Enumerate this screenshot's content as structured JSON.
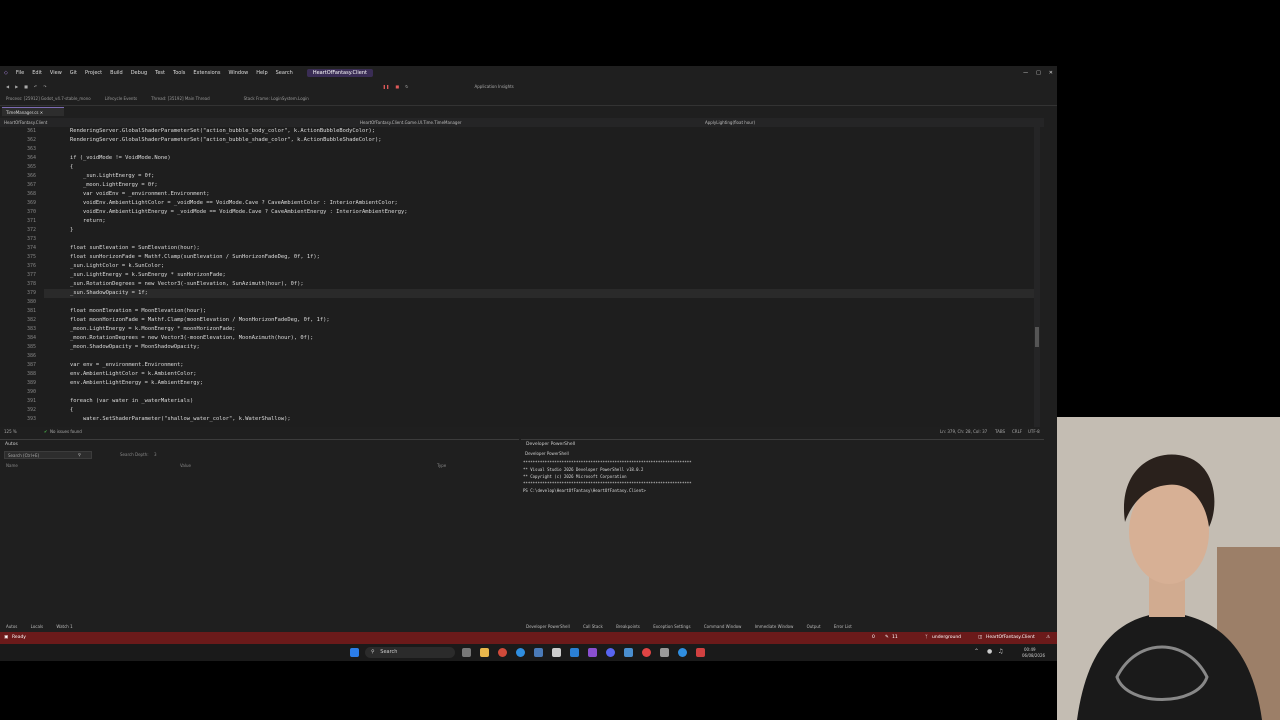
{
  "menu": {
    "items": [
      "File",
      "Edit",
      "View",
      "Git",
      "Project",
      "Build",
      "Debug",
      "Test",
      "Tools",
      "Extensions",
      "Window",
      "Help",
      "Search"
    ],
    "window_title": "HeartOfFantasy.Client"
  },
  "toolbar": {
    "app_insights": "Application Insights",
    "process": "Process: [25912] Godot_v4.7-stable_mono",
    "lifecycle": "Lifecycle Events",
    "thread": "Thread: [35192] Main Thread",
    "stack_frame": "Stack Frame: LoginSystem.Login"
  },
  "tab": {
    "label": "TimeManager.cs"
  },
  "navbar": {
    "project": "HeartOfFantasy.Client",
    "class": "HeartOfFantasy.Client.Game.UI.Time.TimeManager",
    "method": "ApplyLighting(float hour)"
  },
  "code_lines": [
    {
      "n": "361",
      "t": "        RenderingServer.GlobalShaderParameterSet(\"action_bubble_body_color\", k.ActionBubbleBodyColor);"
    },
    {
      "n": "362",
      "t": "        RenderingServer.GlobalShaderParameterSet(\"action_bubble_shade_color\", k.ActionBubbleShadeColor);"
    },
    {
      "n": "363",
      "t": ""
    },
    {
      "n": "364",
      "t": "        if (_voidMode != VoidMode.None)"
    },
    {
      "n": "365",
      "t": "        {"
    },
    {
      "n": "366",
      "t": "            _sun.LightEnergy = 0f;"
    },
    {
      "n": "367",
      "t": "            _moon.LightEnergy = 0f;"
    },
    {
      "n": "368",
      "t": "            var voidEnv = _environment.Environment;"
    },
    {
      "n": "369",
      "t": "            voidEnv.AmbientLightColor = _voidMode == VoidMode.Cave ? CaveAmbientColor : InteriorAmbientColor;"
    },
    {
      "n": "370",
      "t": "            voidEnv.AmbientLightEnergy = _voidMode == VoidMode.Cave ? CaveAmbientEnergy : InteriorAmbientEnergy;"
    },
    {
      "n": "371",
      "t": "            return;"
    },
    {
      "n": "372",
      "t": "        }"
    },
    {
      "n": "373",
      "t": ""
    },
    {
      "n": "374",
      "t": "        float sunElevation = SunElevation(hour);"
    },
    {
      "n": "375",
      "t": "        float sunHorizonFade = Mathf.Clamp(sunElevation / SunHorizonFadeDeg, 0f, 1f);"
    },
    {
      "n": "376",
      "t": "        _sun.LightColor = k.SunColor;"
    },
    {
      "n": "377",
      "t": "        _sun.LightEnergy = k.SunEnergy * sunHorizonFade;"
    },
    {
      "n": "378",
      "t": "        _sun.RotationDegrees = new Vector3(-sunElevation, SunAzimuth(hour), 0f);"
    },
    {
      "n": "379",
      "t": "        _sun.ShadowOpacity = 1f;"
    },
    {
      "n": "380",
      "t": ""
    },
    {
      "n": "381",
      "t": "        float moonElevation = MoonElevation(hour);"
    },
    {
      "n": "382",
      "t": "        float moonHorizonFade = Mathf.Clamp(moonElevation / MoonHorizonFadeDeg, 0f, 1f);"
    },
    {
      "n": "383",
      "t": "        _moon.LightEnergy = k.MoonEnergy * moonHorizonFade;"
    },
    {
      "n": "384",
      "t": "        _moon.RotationDegrees = new Vector3(-moonElevation, MoonAzimuth(hour), 0f);"
    },
    {
      "n": "385",
      "t": "        _moon.ShadowOpacity = MoonShadowOpacity;"
    },
    {
      "n": "386",
      "t": ""
    },
    {
      "n": "387",
      "t": "        var env = _environment.Environment;"
    },
    {
      "n": "388",
      "t": "        env.AmbientLightColor = k.AmbientColor;"
    },
    {
      "n": "389",
      "t": "        env.AmbientLightEnergy = k.AmbientEnergy;"
    },
    {
      "n": "390",
      "t": ""
    },
    {
      "n": "391",
      "t": "        foreach (var water in _waterMaterials)"
    },
    {
      "n": "392",
      "t": "        {"
    },
    {
      "n": "393",
      "t": "            water.SetShaderParameter(\"shallow_water_color\", k.WaterShallow);"
    }
  ],
  "editor_status": {
    "zoom": "125 %",
    "issues": "No issues found",
    "position": "Ln: 379, Ch: 28, Col: 37",
    "tabs": "TABS",
    "eol": "CRLF",
    "encoding": "UTF-8"
  },
  "autos": {
    "title": "Autos",
    "search_placeholder": "Search (Ctrl+E)",
    "search_depth": "Search Depth:",
    "depth_value": "3",
    "col_name": "Name",
    "col_value": "Value",
    "col_type": "Type"
  },
  "terminal": {
    "title": "Developer PowerShell",
    "tab": "Developer PowerShell",
    "lines": [
      "**********************************************************************",
      "** Visual Studio 2026 Developer PowerShell v18.0.2",
      "** Copyright (c) 2026 Microsoft Corporation",
      "**********************************************************************",
      "PS C:\\develop\\HeartOfFantasy\\HeartOfFantasy.Client> "
    ]
  },
  "bottom_tabs_left": [
    "Autos",
    "Locals",
    "Watch 1"
  ],
  "bottom_tabs_right": [
    "Developer PowerShell",
    "Call Stack",
    "Breakpoints",
    "Exception Settings",
    "Command Window",
    "Immediate Window",
    "Output",
    "Error List"
  ],
  "vs_status": {
    "ready": "Ready",
    "branch": "underground",
    "repo": "HeartOfFantasy.Client",
    "errors": "0",
    "changes": "11"
  },
  "taskbar": {
    "search": "Search",
    "time": "00:49",
    "date": "06/08/2026"
  },
  "colors": {
    "status_bar": "#6b1a1a",
    "editor_bg": "#1e1e1e",
    "accent": "#7c6bb3"
  }
}
